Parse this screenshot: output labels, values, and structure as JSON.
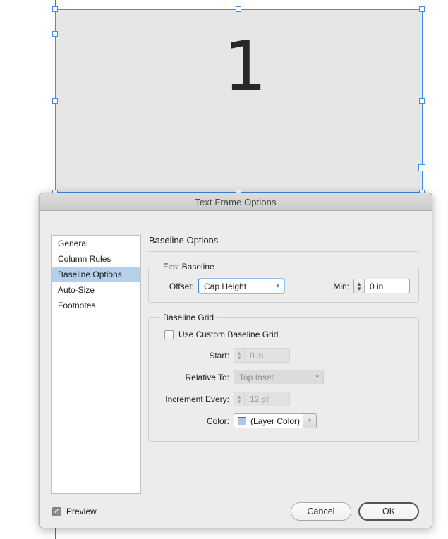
{
  "canvas": {
    "frame_glyph": "1",
    "frame_fill": "#e6e6e6",
    "selection_color": "#3c8fe8",
    "guide_color": "#b9b9b9",
    "margin_guide_color": "#b339b3"
  },
  "dialog": {
    "title": "Text Frame Options",
    "sidebar": {
      "items": [
        {
          "label": "General",
          "selected": false
        },
        {
          "label": "Column Rules",
          "selected": false
        },
        {
          "label": "Baseline Options",
          "selected": true
        },
        {
          "label": "Auto-Size",
          "selected": false
        },
        {
          "label": "Footnotes",
          "selected": false
        }
      ]
    },
    "pane": {
      "title": "Baseline Options",
      "first_baseline": {
        "legend": "First Baseline",
        "offset_label": "Offset:",
        "offset_value": "Cap Height",
        "min_label": "Min:",
        "min_value": "0 in"
      },
      "baseline_grid": {
        "legend": "Baseline Grid",
        "use_custom_label": "Use Custom Baseline Grid",
        "use_custom_checked": false,
        "start_label": "Start:",
        "start_value": "0 in",
        "relative_to_label": "Relative To:",
        "relative_to_value": "Top Inset",
        "increment_label": "Increment Every:",
        "increment_value": "12 pt",
        "color_label": "Color:",
        "color_value": "(Layer Color)",
        "color_swatch": "#a8c8f0"
      }
    },
    "footer": {
      "preview_label": "Preview",
      "preview_checked": true,
      "cancel_label": "Cancel",
      "ok_label": "OK"
    }
  }
}
